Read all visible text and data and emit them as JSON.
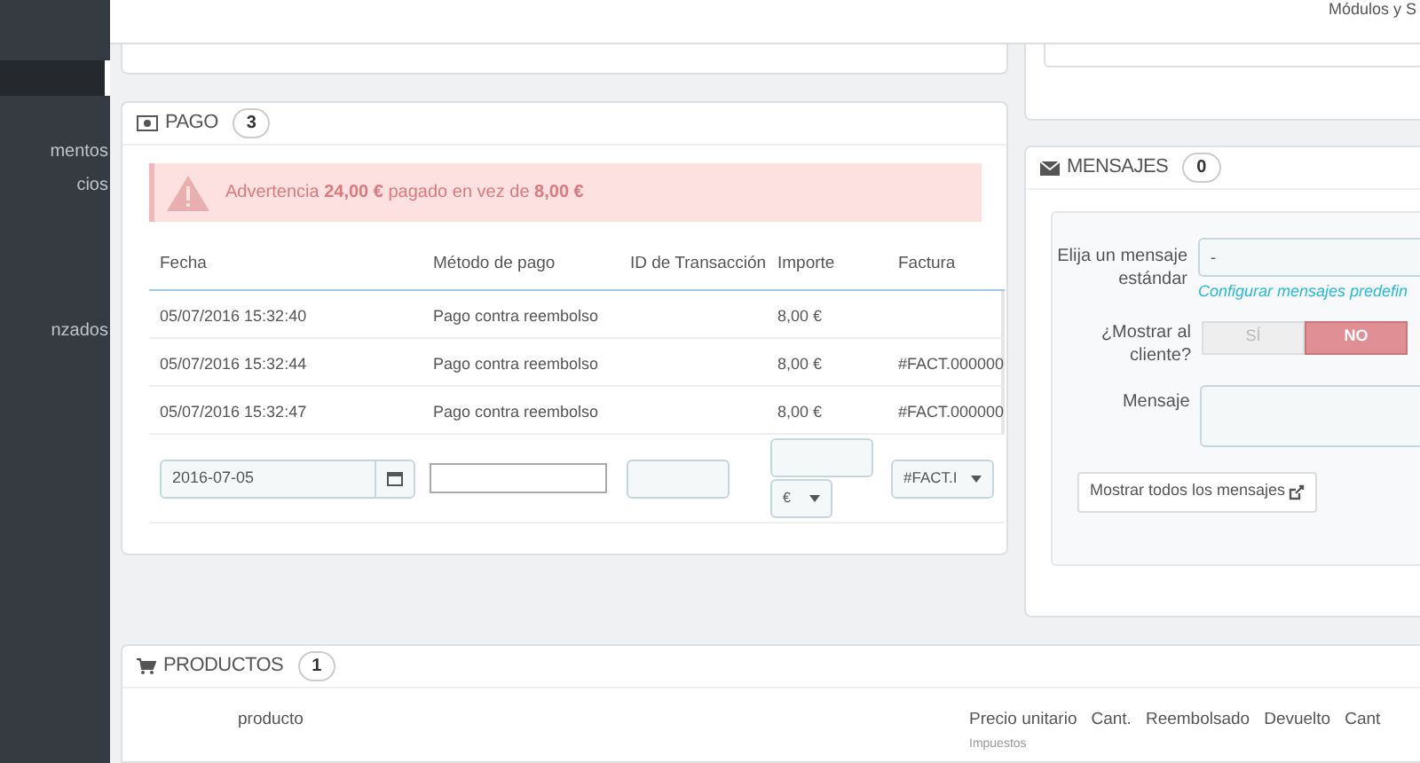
{
  "header": {
    "menu_text": "Módulos y S"
  },
  "sidebar": {
    "items": [
      {
        "label": "mentos",
        "selected": false
      },
      {
        "label": "cios",
        "selected": false
      },
      {
        "label": "nzados",
        "selected": false
      }
    ]
  },
  "payment": {
    "title": "PAGO",
    "count": "3",
    "warning": "Advertencia **24,00 €** pagado en vez de **8,00 €**",
    "columns": [
      "Fecha",
      "Método de pago",
      "ID de Transacción",
      "Importe",
      "Factura"
    ],
    "rows": [
      [
        "05/07/2016 15:32:40",
        "Pago contra reembolso",
        "",
        "8,00 €",
        ""
      ],
      [
        "05/07/2016 15:32:44",
        "Pago contra reembolso",
        "",
        "8,00 €",
        "#FACT.000000"
      ],
      [
        "05/07/2016 15:32:47",
        "Pago contra reembolso",
        "",
        "8,00 €",
        "#FACT.000000"
      ]
    ],
    "form": {
      "date": "2016-07-05",
      "currency": "€",
      "invoice": "#FACT.I"
    }
  },
  "messages": {
    "title": "MENSAJES",
    "count": "0",
    "choose_label": "Elija un mensaje estándar",
    "choose_value": "-",
    "configure_link": "Configurar mensajes predefin",
    "show_label": "¿Mostrar al cliente?",
    "show_options": [
      {
        "label": "SÍ",
        "selected": false
      },
      {
        "label": "NO",
        "selected": true
      }
    ],
    "message_label": "Mensaje",
    "show_all_button": "Mostrar todos los mensajes"
  },
  "products": {
    "title": "PRODUCTOS",
    "count": "1",
    "columns": [
      {
        "label": "producto"
      },
      {
        "label": "Precio unitario",
        "sub": "Impuestos"
      },
      {
        "label": "Cant."
      },
      {
        "label": "Reembolsado"
      },
      {
        "label": "Devuelto"
      },
      {
        "label": "Cant"
      }
    ]
  }
}
